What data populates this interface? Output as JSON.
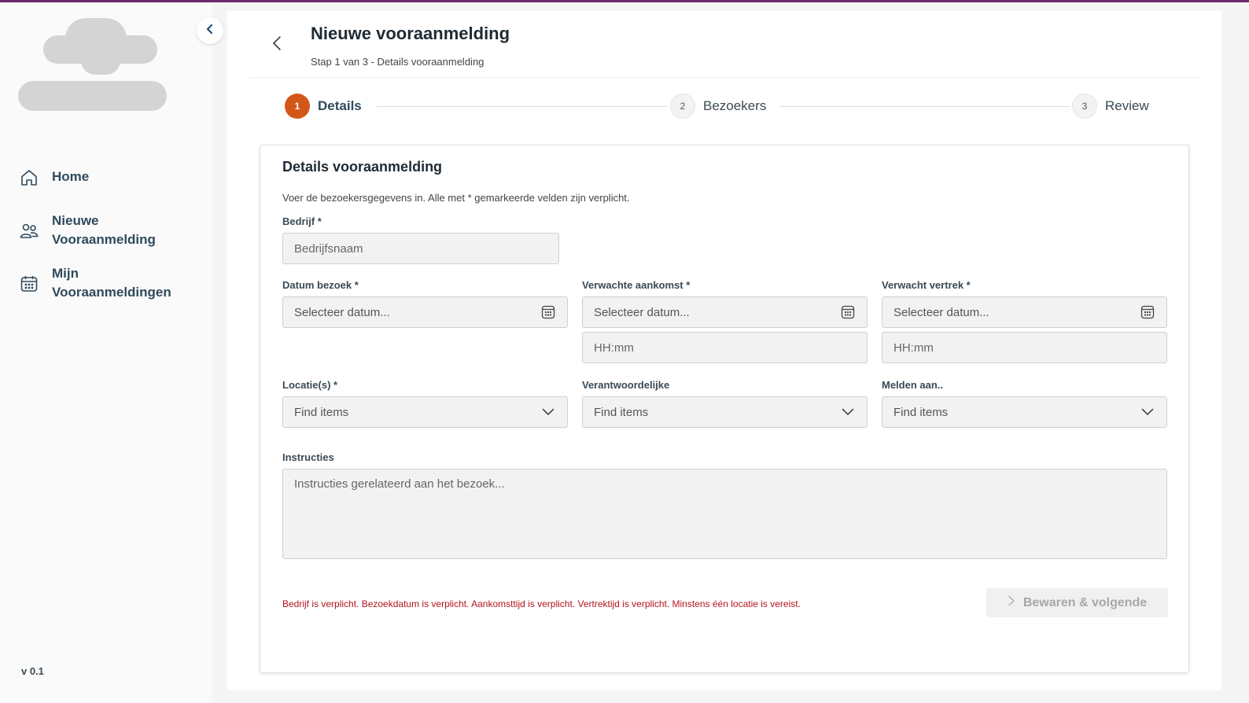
{
  "colors": {
    "accent": "#d4571a",
    "brand_bar": "#6b2a6b",
    "error": "#b3141e"
  },
  "sidebar": {
    "items": [
      {
        "label": "Home",
        "icon": "home-icon"
      },
      {
        "label": "Nieuwe Vooraanmelding",
        "icon": "users-icon"
      },
      {
        "label": "Mijn Vooraanmeldingen",
        "icon": "calendar-icon"
      }
    ],
    "version": "v 0.1"
  },
  "header": {
    "title": "Nieuwe vooraanmelding",
    "subtitle": "Stap 1 van 3 - Details vooraanmelding"
  },
  "stepper": {
    "steps": [
      {
        "number": "1",
        "label": "Details",
        "active": true
      },
      {
        "number": "2",
        "label": "Bezoekers",
        "active": false
      },
      {
        "number": "3",
        "label": "Review",
        "active": false
      }
    ]
  },
  "form": {
    "title": "Details vooraanmelding",
    "description": "Voer de bezoekersgegevens in. Alle met * gemarkeerde velden zijn verplicht.",
    "company": {
      "label": "Bedrijf *",
      "placeholder": "Bedrijfsnaam"
    },
    "visit_date": {
      "label": "Datum bezoek *",
      "placeholder": "Selecteer datum..."
    },
    "arrival": {
      "label": "Verwachte aankomst *",
      "date_placeholder": "Selecteer datum...",
      "time_placeholder": "HH:mm"
    },
    "departure": {
      "label": "Verwacht vertrek *",
      "date_placeholder": "Selecteer datum...",
      "time_placeholder": "HH:mm"
    },
    "locations": {
      "label": "Locatie(s) *",
      "placeholder": "Find items"
    },
    "responsible": {
      "label": "Verantwoordelijke",
      "placeholder": "Find items"
    },
    "report_to": {
      "label": "Melden aan..",
      "placeholder": "Find items"
    },
    "instructions": {
      "label": "Instructies",
      "placeholder": "Instructies gerelateerd aan het bezoek..."
    },
    "error": "Bedrijf is verplicht. Bezoekdatum is verplicht. Aankomsttijd is verplicht. Vertrektijd is verplicht. Minstens één locatie is vereist.",
    "submit_label": "Bewaren & volgende"
  }
}
